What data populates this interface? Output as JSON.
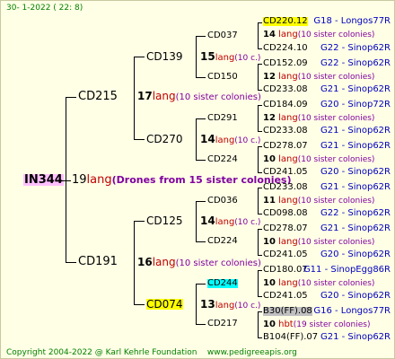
{
  "header": {
    "date": "30-  1-2022 (  22:  8)"
  },
  "footer": {
    "copyright": "Copyright 2004-2022 @ Karl Kehrle Foundation",
    "site": "www.pedigreeapis.org"
  },
  "root": {
    "name": "IN344",
    "num": "19",
    "word": "lang",
    "note": "(Drones from 15 sister colonies)"
  },
  "gen1": [
    {
      "name": "CD215",
      "num": "17",
      "word": "lang",
      "note": "(10 sister colonies)"
    },
    {
      "name": "CD191",
      "num": "16",
      "word": "lang",
      "note": "(10 sister colonies)"
    }
  ],
  "gen2": [
    {
      "name": "CD139",
      "num": "15",
      "word": "lang",
      "note": "(10 c.)"
    },
    {
      "name": "CD270",
      "num": "14",
      "word": "lang",
      "note": "(10 c.)"
    },
    {
      "name": "CD125",
      "num": "14",
      "word": "lang",
      "note": "(10 c.)"
    },
    {
      "name": "CD074",
      "num": "13",
      "word": "lang",
      "note": "(10 c.)"
    }
  ],
  "gen3": [
    {
      "name": "CD037"
    },
    {
      "name": "CD150"
    },
    {
      "name": "CD291"
    },
    {
      "name": "CD224"
    },
    {
      "name": "CD036"
    },
    {
      "name": "CD224"
    },
    {
      "name": "CD244"
    },
    {
      "name": "CD217"
    }
  ],
  "gen4": [
    {
      "top": "CD220.12",
      "topcode": "G18 - Longos77R",
      "num": "14",
      "word": "lang",
      "note": "(10 sister colonies)",
      "bot": "CD224.10",
      "botcode": "G22 - Sinop62R"
    },
    {
      "top": "CD152.09",
      "topcode": "G22 - Sinop62R",
      "num": "12",
      "word": "lang",
      "note": "(10 sister colonies)",
      "bot": "CD233.08",
      "botcode": "G21 - Sinop62R"
    },
    {
      "top": "CD184.09",
      "topcode": "G20 - Sinop72R",
      "num": "12",
      "word": "lang",
      "note": "(10 sister colonies)",
      "bot": "CD233.08",
      "botcode": "G21 - Sinop62R"
    },
    {
      "top": "CD278.07",
      "topcode": "G21 - Sinop62R",
      "num": "10",
      "word": "lang",
      "note": "(10 sister colonies)",
      "bot": "CD241.05",
      "botcode": "G20 - Sinop62R"
    },
    {
      "top": "CD233.08",
      "topcode": "G21 - Sinop62R",
      "num": "11",
      "word": "lang",
      "note": "(10 sister colonies)",
      "bot": "CD098.08",
      "botcode": "G22 - Sinop62R"
    },
    {
      "top": "CD278.07",
      "topcode": "G21 - Sinop62R",
      "num": "10",
      "word": "lang",
      "note": "(10 sister colonies)",
      "bot": "CD241.05",
      "botcode": "G20 - Sinop62R"
    },
    {
      "top": "CD180.07",
      "topcode": "G11 - SinopEgg86R",
      "num": "10",
      "word": "lang",
      "note": "(10 sister colonies)",
      "bot": "CD241.05",
      "botcode": "G20 - Sinop62R"
    },
    {
      "top": "B30(FF).08",
      "topcode": "G16 - Longos77R",
      "num": "10",
      "word": "hbt",
      "note": "(19 sister colonies)",
      "bot": "B104(FF).07",
      "botcode": "G21 - Sinop62R"
    }
  ]
}
